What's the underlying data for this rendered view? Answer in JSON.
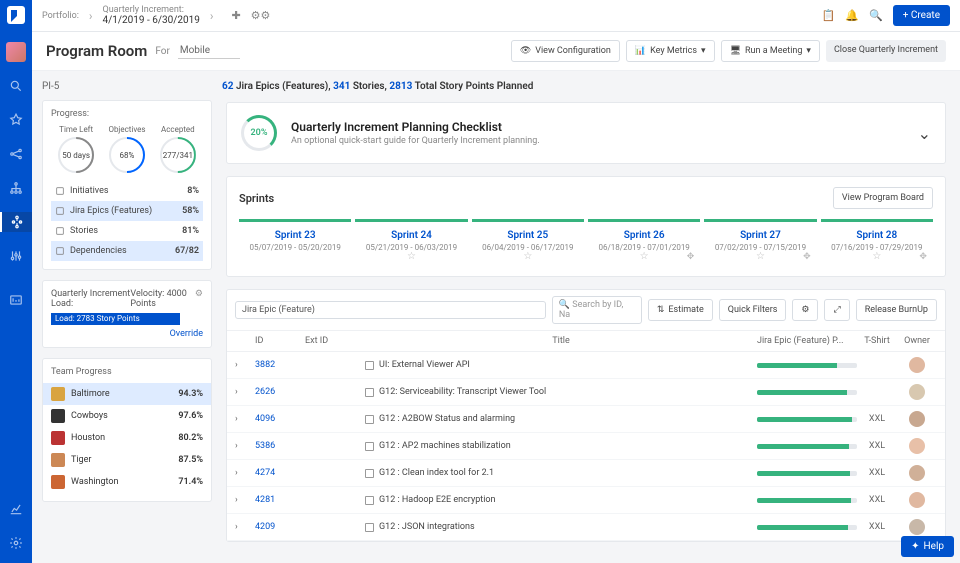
{
  "topbar": {
    "portfolio_lbl": "Portfolio:",
    "qi_lbl": "Quarterly Increment:",
    "qi_val": "4/1/2019 - 6/30/2019",
    "create": "+ Create"
  },
  "header": {
    "title": "Program Room",
    "for": "For",
    "mobile": "Mobile",
    "view_config": "View Configuration",
    "key_metrics": "Key Metrics",
    "run_meeting": "Run a Meeting",
    "close_qi": "Close Quarterly Increment"
  },
  "pi": "PI-5",
  "summary": {
    "epics": "62",
    "epics_lbl": "Jira Epics (Features),",
    "stories": "341",
    "stories_lbl": "Stories,",
    "points": "2813",
    "points_lbl": "Total Story Points Planned"
  },
  "progress": {
    "lbl": "Progress:",
    "rings": [
      {
        "title": "Time Left",
        "val": "50 days",
        "color": "#888"
      },
      {
        "title": "Objectives",
        "val": "68%",
        "color": "#0065ff"
      },
      {
        "title": "Accepted",
        "val": "277/341",
        "color": "#36b37e"
      }
    ],
    "rows": [
      {
        "name": "initiatives-row",
        "label": "Initiatives",
        "val": "8%",
        "sel": false
      },
      {
        "name": "epics-row",
        "label": "Jira Epics (Features)",
        "val": "58%",
        "sel": true
      },
      {
        "name": "stories-row",
        "label": "Stories",
        "val": "81%",
        "sel": false
      },
      {
        "name": "deps-row",
        "label": "Dependencies",
        "val": "67/82",
        "sel": true
      }
    ]
  },
  "qi_load": {
    "lbl": "Quarterly Increment Load:",
    "vel": "Velocity: 4000 Points",
    "bar": "Load: 2783 Story Points",
    "override": "Override"
  },
  "teams": {
    "lbl": "Team Progress",
    "items": [
      {
        "name": "Baltimore",
        "pct": "94.3%",
        "c": "#d9a441"
      },
      {
        "name": "Cowboys",
        "pct": "97.6%",
        "c": "#333"
      },
      {
        "name": "Houston",
        "pct": "80.2%",
        "c": "#b33"
      },
      {
        "name": "Tiger",
        "pct": "87.5%",
        "c": "#c85"
      },
      {
        "name": "Washington",
        "pct": "71.4%",
        "c": "#c63"
      }
    ]
  },
  "checklist": {
    "pct": "20%",
    "title": "Quarterly Increment Planning Checklist",
    "sub": "An optional quick-start guide for Quarterly Increment planning."
  },
  "sprints": {
    "title": "Sprints",
    "btn": "View Program Board",
    "items": [
      {
        "name": "Sprint 23",
        "dates": "05/07/2019 - 05/20/2019"
      },
      {
        "name": "Sprint 24",
        "dates": "05/21/2019 - 06/03/2019"
      },
      {
        "name": "Sprint 25",
        "dates": "06/04/2019 - 06/17/2019"
      },
      {
        "name": "Sprint 26",
        "dates": "06/18/2019 - 07/01/2019"
      },
      {
        "name": "Sprint 27",
        "dates": "07/02/2019 - 07/15/2019"
      },
      {
        "name": "Sprint 28",
        "dates": "07/16/2019 - 07/29/2019"
      }
    ]
  },
  "table": {
    "filter": "Jira Epic (Feature)",
    "search": "Search by ID, Na",
    "estimate": "Estimate",
    "quick": "Quick Filters",
    "release": "Release BurnUp",
    "cols": {
      "id": "ID",
      "ext": "Ext ID",
      "title": "Title",
      "prog": "Jira Epic (Feature) P...",
      "ts": "T-Shirt",
      "own": "Owner"
    },
    "rows": [
      {
        "id": "3882",
        "title": "UI: External Viewer API",
        "prog": 80,
        "ts": "",
        "av": "#e0b8a0"
      },
      {
        "id": "2626",
        "title": "G12: Serviceability: Transcript Viewer Tool",
        "prog": 90,
        "ts": "",
        "av": "#d8c8b0"
      },
      {
        "id": "4096",
        "title": "G12 : A2BOW Status and alarming",
        "prog": 95,
        "ts": "XXL",
        "av": "#c8a890"
      },
      {
        "id": "5386",
        "title": "G12 : AP2 machines stabilization",
        "prog": 92,
        "ts": "XXL",
        "av": "#e8c0a8"
      },
      {
        "id": "4274",
        "title": "G12 : Clean index tool for 2.1",
        "prog": 93,
        "ts": "XXL",
        "av": "#d0b098"
      },
      {
        "id": "4281",
        "title": "G12 : Hadoop E2E encryption",
        "prog": 94,
        "ts": "XXL",
        "av": "#e0b8a0"
      },
      {
        "id": "4209",
        "title": "G12 : JSON integrations",
        "prog": 91,
        "ts": "XXL",
        "av": "#c8b8a8"
      }
    ]
  },
  "help": "Help"
}
